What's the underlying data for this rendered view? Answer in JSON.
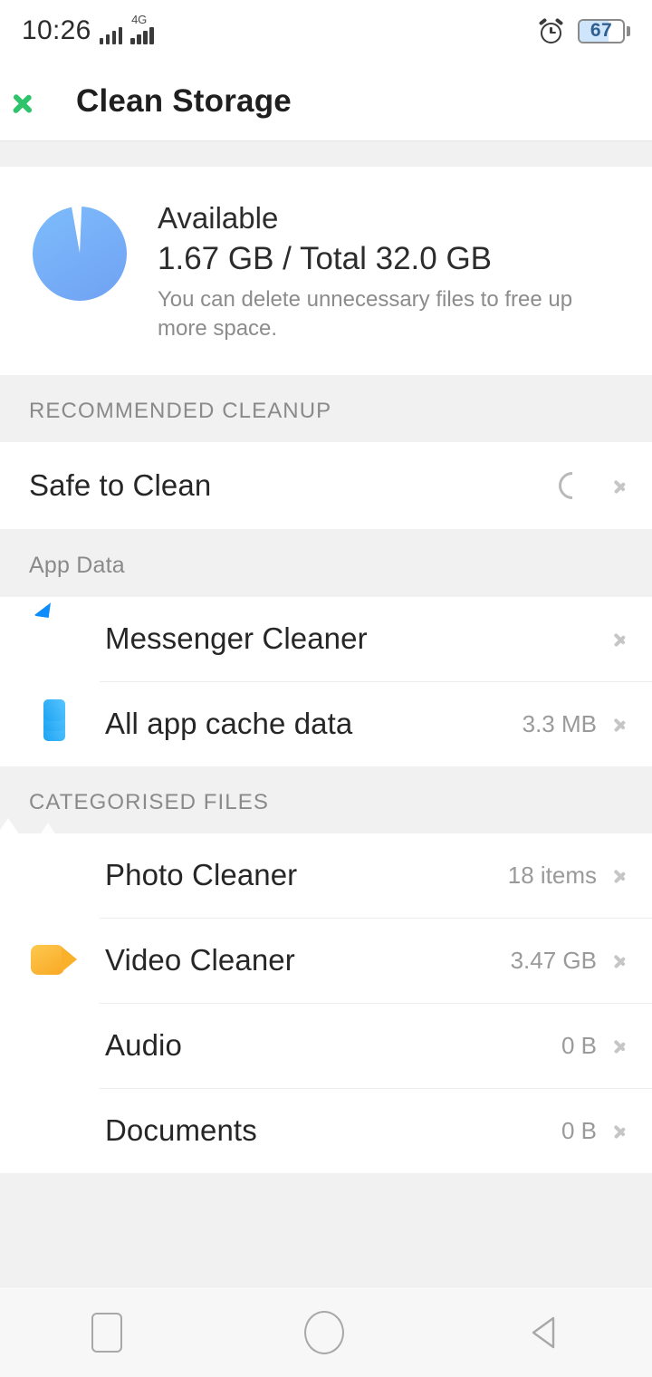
{
  "statusbar": {
    "time": "10:26",
    "network_label": "4G",
    "battery_level": "67",
    "alarm_icon": "alarm-clock-icon",
    "signal_icon": "signal-bars-icon"
  },
  "titlebar": {
    "back_icon": "back-chevron-icon",
    "title": "Clean Storage"
  },
  "summary": {
    "available_label": "Available",
    "size_line": "1.67 GB / Total 32.0 GB",
    "description": "You can delete unnecessary files to free up more space.",
    "pie_icon": "storage-pie-chart"
  },
  "chart_data": {
    "type": "pie",
    "title": "Available storage",
    "categories": [
      "Used",
      "Available"
    ],
    "values": [
      30.33,
      1.67
    ],
    "units": "GB",
    "total": 32.0,
    "colors": [
      "#78b0f8",
      "#ffffff"
    ],
    "legend": "none"
  },
  "sections": [
    {
      "header": "RECOMMENDED CLEANUP",
      "header_style": "caps",
      "rows": [
        {
          "name": "safe-to-clean",
          "label": "Safe to Clean",
          "value": "",
          "icon": "none",
          "spinner": true
        }
      ]
    },
    {
      "header": "App Data",
      "header_style": "normal",
      "rows": [
        {
          "name": "messenger-cleaner",
          "label": "Messenger Cleaner",
          "value": "",
          "icon": "messenger-icon",
          "spinner": false
        },
        {
          "name": "all-app-cache-data",
          "label": "All app cache data",
          "value": "3.3 MB",
          "icon": "layers-icon",
          "spinner": false
        }
      ]
    },
    {
      "header": "CATEGORISED FILES",
      "header_style": "caps",
      "rows": [
        {
          "name": "photo-cleaner",
          "label": "Photo Cleaner",
          "value": "18 items",
          "icon": "photo-icon",
          "spinner": false
        },
        {
          "name": "video-cleaner",
          "label": "Video Cleaner",
          "value": "3.47 GB",
          "icon": "video-icon",
          "spinner": false
        },
        {
          "name": "audio",
          "label": "Audio",
          "value": "0 B",
          "icon": "audio-icon",
          "spinner": false
        },
        {
          "name": "documents",
          "label": "Documents",
          "value": "0 B",
          "icon": "document-icon",
          "spinner": false
        }
      ]
    }
  ],
  "navbar": {
    "recent_icon": "recent-apps-icon",
    "home_icon": "home-icon",
    "back_icon": "back-nav-icon"
  },
  "colors": {
    "accent_green": "#2FC36B",
    "pie_blue": "#78b0f8",
    "battery_fill": "#cfe5fb",
    "section_bg": "#f1f1f1"
  }
}
